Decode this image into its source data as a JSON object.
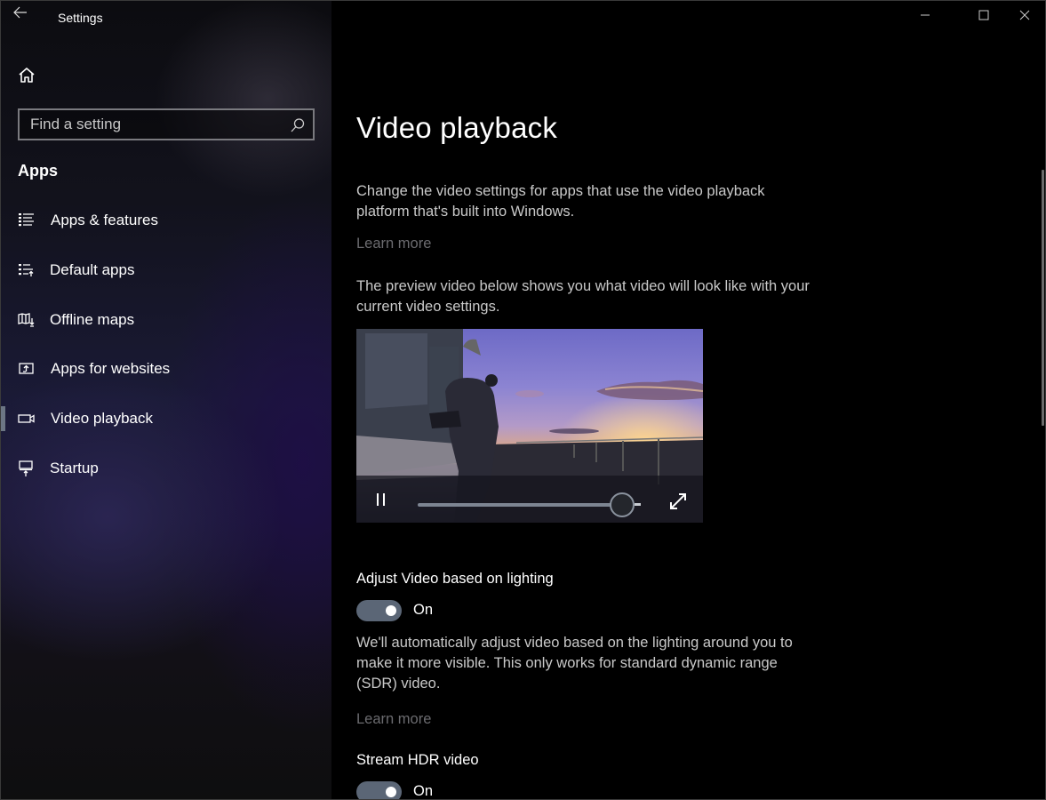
{
  "window": {
    "title": "Settings",
    "controls": {
      "minimize": "minimize-icon",
      "maximize": "maximize-icon",
      "close": "close-icon"
    }
  },
  "sidebar": {
    "back_icon": "back-arrow-icon",
    "home_icon": "home-icon",
    "search": {
      "placeholder": "Find a setting",
      "value": "",
      "icon": "search-icon"
    },
    "section_heading": "Apps",
    "items": [
      {
        "label": "Apps & features",
        "icon": "apps-features-icon",
        "active": false
      },
      {
        "label": "Default apps",
        "icon": "default-apps-icon",
        "active": false
      },
      {
        "label": "Offline maps",
        "icon": "offline-maps-icon",
        "active": false
      },
      {
        "label": "Apps for websites",
        "icon": "apps-for-websites-icon",
        "active": false
      },
      {
        "label": "Video playback",
        "icon": "video-camera-icon",
        "active": true
      },
      {
        "label": "Startup",
        "icon": "startup-icon",
        "active": false
      }
    ]
  },
  "main": {
    "title": "Video playback",
    "intro": "Change the video settings for apps that use the video playback platform that's built into Windows.",
    "intro_link": "Learn more",
    "preview_text": "The preview video below shows you what video will look like with your current video settings.",
    "video_player": {
      "state": "playing",
      "progress_fraction": 0.95,
      "pause_icon": "pause-icon",
      "fullscreen_icon": "fullscreen-icon"
    },
    "settings": [
      {
        "label": "Adjust Video based on lighting",
        "toggle_state": "On",
        "enabled": true,
        "description": "We'll automatically adjust video based on the lighting around you to make it more visible. This only works for standard dynamic range (SDR) video.",
        "link": "Learn more"
      },
      {
        "label": "Stream HDR video",
        "toggle_state": "On",
        "enabled": true
      }
    ]
  },
  "colors": {
    "toggle_on": "#5b6676",
    "link": "#6b6b6f",
    "selection_bar": "#6c7684"
  }
}
